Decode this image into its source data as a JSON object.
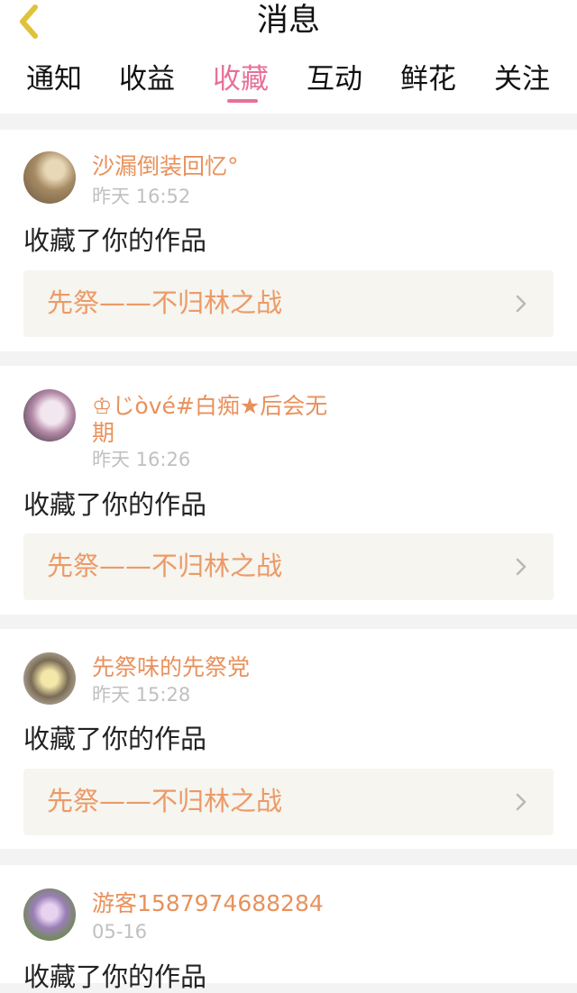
{
  "header": {
    "title": "消息"
  },
  "tabs": [
    {
      "label": "通知"
    },
    {
      "label": "收益"
    },
    {
      "label": "收藏"
    },
    {
      "label": "互动"
    },
    {
      "label": "鲜花"
    },
    {
      "label": "关注"
    }
  ],
  "active_tab": "收藏",
  "colors": {
    "accent": "#e8709a",
    "username": "#e8915c",
    "work_title": "#ec9a67",
    "back_icon": "#e0c23a"
  },
  "feed": [
    {
      "name": "沙漏倒装回忆°",
      "time": "昨天 16:52",
      "action": "收藏了你的作品",
      "work": "先祭——不归林之战"
    },
    {
      "name_line1": "♔じòvé#白痴★后会无",
      "name_line2": "期",
      "time": "昨天 16:26",
      "action": "收藏了你的作品",
      "work": "先祭——不归林之战"
    },
    {
      "name": "先祭味的先祭党",
      "time": "昨天 15:28",
      "action": "收藏了你的作品",
      "work": "先祭——不归林之战"
    },
    {
      "name": "游客1587974688284",
      "time": "05-16",
      "action": "收藏了你的作品"
    }
  ]
}
